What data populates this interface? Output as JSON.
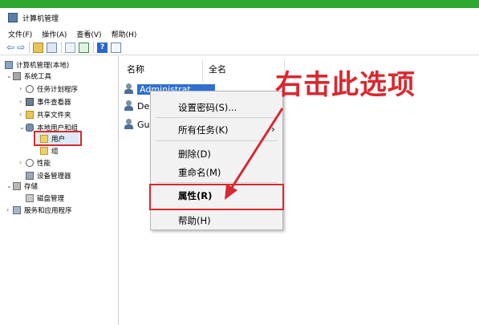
{
  "window": {
    "title": "计算机管理"
  },
  "menu": {
    "file": "文件(F)",
    "action": "操作(A)",
    "view": "查看(V)",
    "help": "帮助(H)"
  },
  "tree": {
    "root": "计算机管理(本地)",
    "system_tools": "系统工具",
    "task_scheduler": "任务计划程序",
    "event_viewer": "事件查看器",
    "shared_folders": "共享文件夹",
    "local_users_groups": "本地用户和组",
    "users": "用户",
    "groups": "组",
    "performance": "性能",
    "device_manager": "设备管理器",
    "storage": "存储",
    "disk_management": "磁盘管理",
    "services_apps": "服务和应用程序"
  },
  "list": {
    "columns": [
      "名称",
      "全名"
    ],
    "rows": [
      "Administrat...",
      "De",
      "Gu"
    ]
  },
  "context_menu": {
    "set_password": "设置密码(S)...",
    "all_tasks": "所有任务(K)",
    "delete": "删除(D)",
    "rename": "重命名(M)",
    "properties": "属性(R)",
    "help": "帮助(H)"
  },
  "annotation": {
    "callout_text": "右击此选项"
  },
  "colors": {
    "highlight": "#2f6fcf",
    "accent_red": "#d9282f",
    "window_bar": "#2fa82f"
  }
}
